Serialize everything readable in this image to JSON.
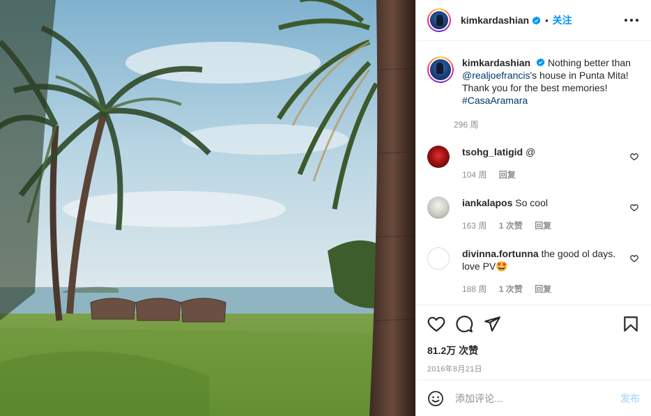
{
  "colors": {
    "accent": "#0095f6",
    "link": "#00376b",
    "muted": "#8e8e8e",
    "post_disabled": "#b2dffc"
  },
  "header": {
    "username": "kimkardashian",
    "separator": "•",
    "follow_label": "关注",
    "more_icon": "more-horizontal-icon"
  },
  "caption": {
    "username": "kimkardashian",
    "text_before": "Nothing better than ",
    "mention": "@realjoefrancis",
    "text_after": "'s house in Punta Mita! Thank you for the best memories! ",
    "hashtag": "#CasaAramara",
    "time": "296 周"
  },
  "comments": [
    {
      "username": "tsohg_latigid",
      "text": "@",
      "time": "104 周",
      "likes": "",
      "reply": "回复"
    },
    {
      "username": "iankalapos",
      "text": "So cool",
      "time": "163 周",
      "likes": "1 次赞",
      "reply": "回复"
    },
    {
      "username": "divinna.fortunna",
      "text": "the good ol days. love PV🤩",
      "time": "188 周",
      "likes": "1 次赞",
      "reply": "回复"
    }
  ],
  "actions": {
    "like_icon": "heart-icon",
    "comment_icon": "comment-icon",
    "share_icon": "share-icon",
    "save_icon": "bookmark-icon"
  },
  "likes": "81.2万 次赞",
  "date": "2016年8月21日",
  "comment_box": {
    "placeholder": "添加评论...",
    "post_label": "发布",
    "emoji_icon": "emoji-icon"
  }
}
